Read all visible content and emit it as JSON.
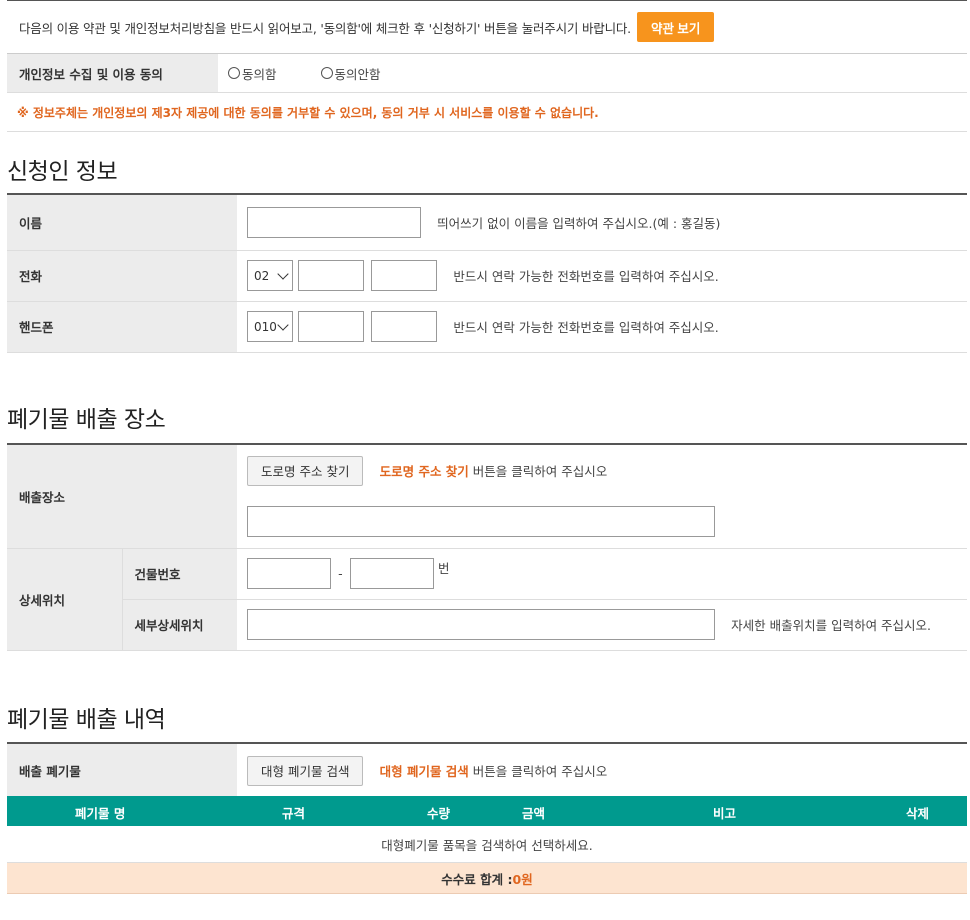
{
  "notice": {
    "text": "다음의 이용 약관 및 개인정보처리방침을 반드시 읽어보고, '동의함'에 체크한 후 '신청하기' 버튼을 눌러주시기 바랍니다.",
    "terms_button": "약관 보기"
  },
  "consent": {
    "label": "개인정보 수집 및 이용 동의",
    "agree": "동의함",
    "disagree": "동의안함",
    "warning": "※ 정보주체는 개인정보의 제3자 제공에 대한 동의를 거부할 수 있으며, 동의 거부 시 서비스를 이용할 수 없습니다."
  },
  "applicant": {
    "title": "신청인 정보",
    "name_label": "이름",
    "name_hint": "띄어쓰기 없이 이름을 입력하여 주십시오.(예 : 홍길동)",
    "phone_label": "전화",
    "phone_prefix": "02",
    "phone_hint": "반드시 연락 가능한 전화번호를 입력하여 주십시오.",
    "mobile_label": "핸드폰",
    "mobile_prefix": "010",
    "mobile_hint": "반드시 연락 가능한 전화번호를 입력하여 주십시오."
  },
  "location": {
    "title": "폐기물 배출 장소",
    "place_label": "배출장소",
    "road_button": "도로명 주소 찾기",
    "road_hint_em": "도로명 주소 찾기",
    "road_hint_rest": " 버튼을 클릭하여 주십시오",
    "detail_label": "상세위치",
    "building_label": "건물번호",
    "dash": "-",
    "beon": "번",
    "subdetail_label": "세부상세위치",
    "subdetail_hint": "자세한 배출위치를 입력하여 주십시오."
  },
  "history": {
    "title": "폐기물 배출 내역",
    "waste_label": "배출 폐기물",
    "search_button": "대형 폐기물 검색",
    "search_hint_em": "대형 폐기물 검색",
    "search_hint_rest": " 버튼을 클릭하여 주십시오",
    "columns": [
      "폐기물 명",
      "규격",
      "수량",
      "금액",
      "비고",
      "삭제"
    ],
    "empty_text": "대형폐기물 품목을 검색하여 선택하세요.",
    "total_label": "수수료 합계 : ",
    "total_value": "0원"
  },
  "colors": {
    "accent": "#f7941d",
    "teal": "#009a8e",
    "warning": "#e0661f"
  }
}
